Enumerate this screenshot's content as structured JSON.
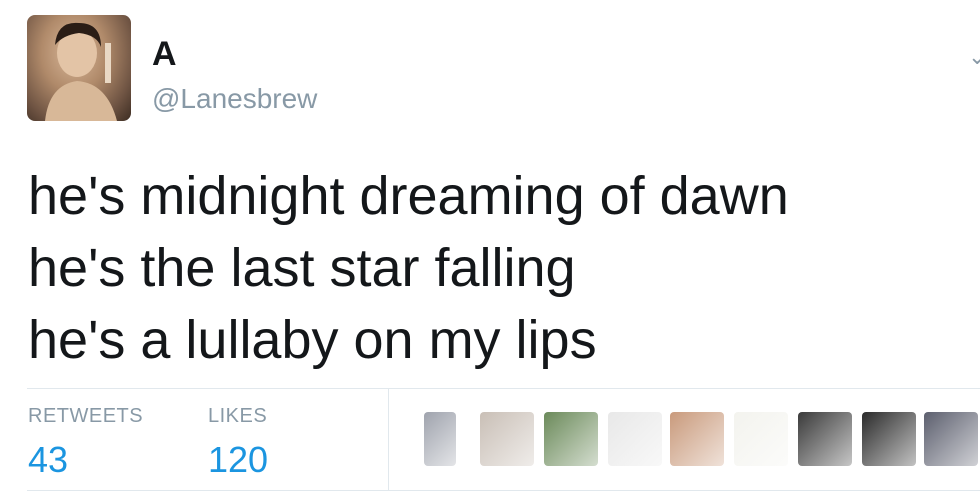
{
  "user": {
    "display_name": "A",
    "handle": "@Lanesbrew"
  },
  "tweet": {
    "lines": [
      "he's midnight dreaming of dawn",
      "he's the last star falling",
      "he's a lullaby on my lips"
    ]
  },
  "stats": {
    "retweets_label": "RETWEETS",
    "retweets_count": "43",
    "likes_label": "LIKES",
    "likes_count": "120"
  },
  "likers": [
    {
      "color": "#9fa3ad"
    },
    {
      "color": "#c9bfb6"
    },
    {
      "color": "#6b8a5a"
    },
    {
      "color": "#e8e8e8"
    },
    {
      "color": "#c99a7c"
    },
    {
      "color": "#f3f3ee"
    },
    {
      "color": "#3a3a3a"
    },
    {
      "color": "#2b2b2b"
    },
    {
      "color": "#5c5f6e"
    }
  ]
}
